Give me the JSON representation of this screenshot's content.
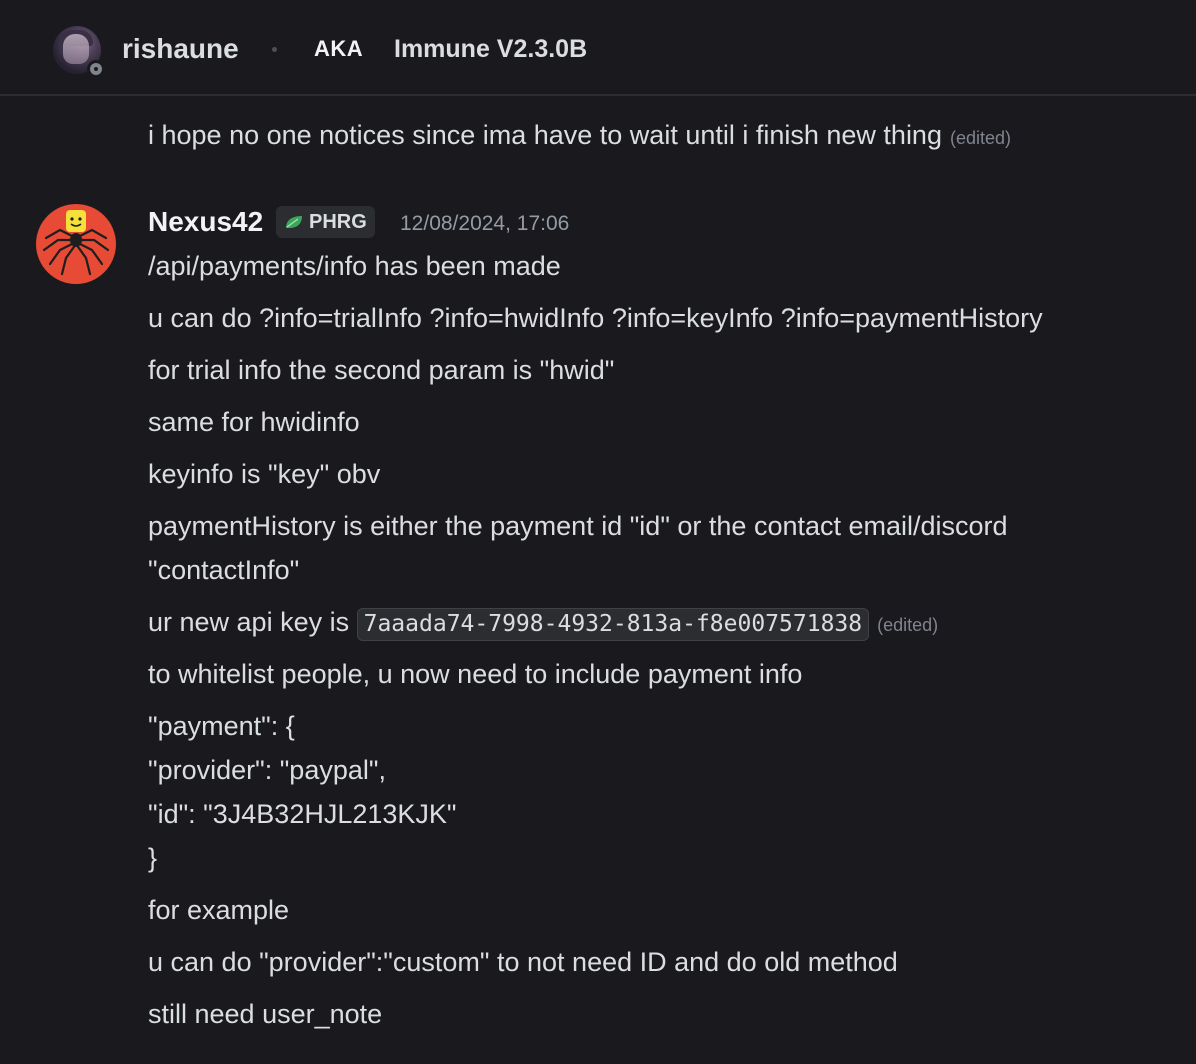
{
  "header": {
    "username": "rishaune",
    "tag": "AKA",
    "tag_name": "Immune V2.3.0B"
  },
  "previous_message": {
    "text": "i hope no one notices since ima have to wait until i finish new thing",
    "edited_label": "(edited)"
  },
  "message": {
    "author": "Nexus42",
    "role_tag": "PHRG",
    "timestamp": "12/08/2024, 17:06",
    "lines": [
      "/api/payments/info has been made",
      "u can do ?info=trialInfo ?info=hwidInfo ?info=keyInfo ?info=paymentHistory",
      "for trial info the second param is \"hwid\"",
      "same for hwidinfo",
      "keyinfo is \"key\" obv",
      "paymentHistory is either the payment id \"id\" or the contact email/discord",
      "\"contactInfo\""
    ],
    "api_key_prefix": "ur new api key is",
    "api_key": "7aaada74-7998-4932-813a-f8e007571838",
    "api_key_edited_label": "(edited)",
    "lines_after": [
      "to whitelist people, u now need to include payment info",
      "\"payment\": {",
      "\"provider\": \"paypal\",",
      "\"id\": \"3J4B32HJL213KJK\"",
      "}",
      "for example",
      "u can do \"provider\":\"custom\" to not need ID and do old method",
      "still need user_note"
    ]
  },
  "colors": {
    "background": "#1a1a1e",
    "text": "#dbdee1",
    "muted": "#949ba4",
    "avatar_red": "#e74a35",
    "leaf_green": "#3ba55c"
  }
}
